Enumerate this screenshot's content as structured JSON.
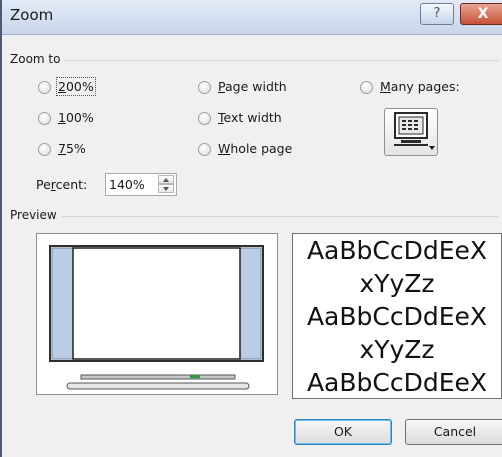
{
  "window": {
    "title": "Zoom",
    "help_icon": "help-question-icon",
    "close_icon": "close-x-icon",
    "help_glyph": "?",
    "close_glyph": "X"
  },
  "zoom_to": {
    "label": "Zoom to",
    "options": {
      "p200": {
        "key": "2",
        "rest": "00%"
      },
      "p100": {
        "key": "1",
        "rest": "00%"
      },
      "p75": {
        "key": "7",
        "rest": "5%"
      },
      "page_width": {
        "key": "P",
        "rest": "age width"
      },
      "text_width": {
        "key": "T",
        "rest": "ext width"
      },
      "whole_page": {
        "key": "W",
        "rest": "hole page"
      },
      "many_pages": {
        "key": "M",
        "rest": "any pages:"
      }
    },
    "selected": "none",
    "many_pages_icon": "monitor-pages-icon"
  },
  "percent": {
    "label_pre": "Pe",
    "label_key": "r",
    "label_post": "cent:",
    "value": "140%"
  },
  "preview": {
    "label": "Preview",
    "sample_lines": [
      "AaBbCcDdEeX",
      "xYyZz",
      "AaBbCcDdEeX",
      "xYyZz",
      "AaBbCcDdEeX"
    ]
  },
  "buttons": {
    "ok": "OK",
    "cancel": "Cancel"
  },
  "colors": {
    "title_gradient_top": "#e3eaf6",
    "close_red": "#c65238",
    "preview_side_panel": "#b9cde5"
  }
}
